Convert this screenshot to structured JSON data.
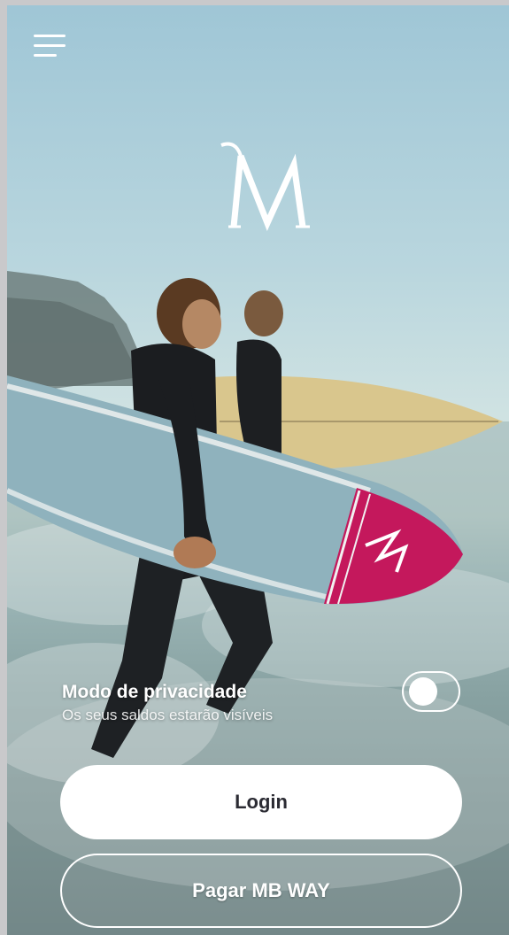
{
  "header": {
    "menu_icon": "hamburger-menu-icon",
    "logo_icon": "millennium-m-logo"
  },
  "privacy": {
    "title": "Modo de privacidade",
    "subtitle": "Os seus saldos estarão visíveis",
    "toggle_on": false
  },
  "actions": {
    "login_label": "Login",
    "mbway_label": "Pagar MB WAY"
  },
  "colors": {
    "brand": "#c4185c",
    "button_text": "#2b2b33"
  }
}
